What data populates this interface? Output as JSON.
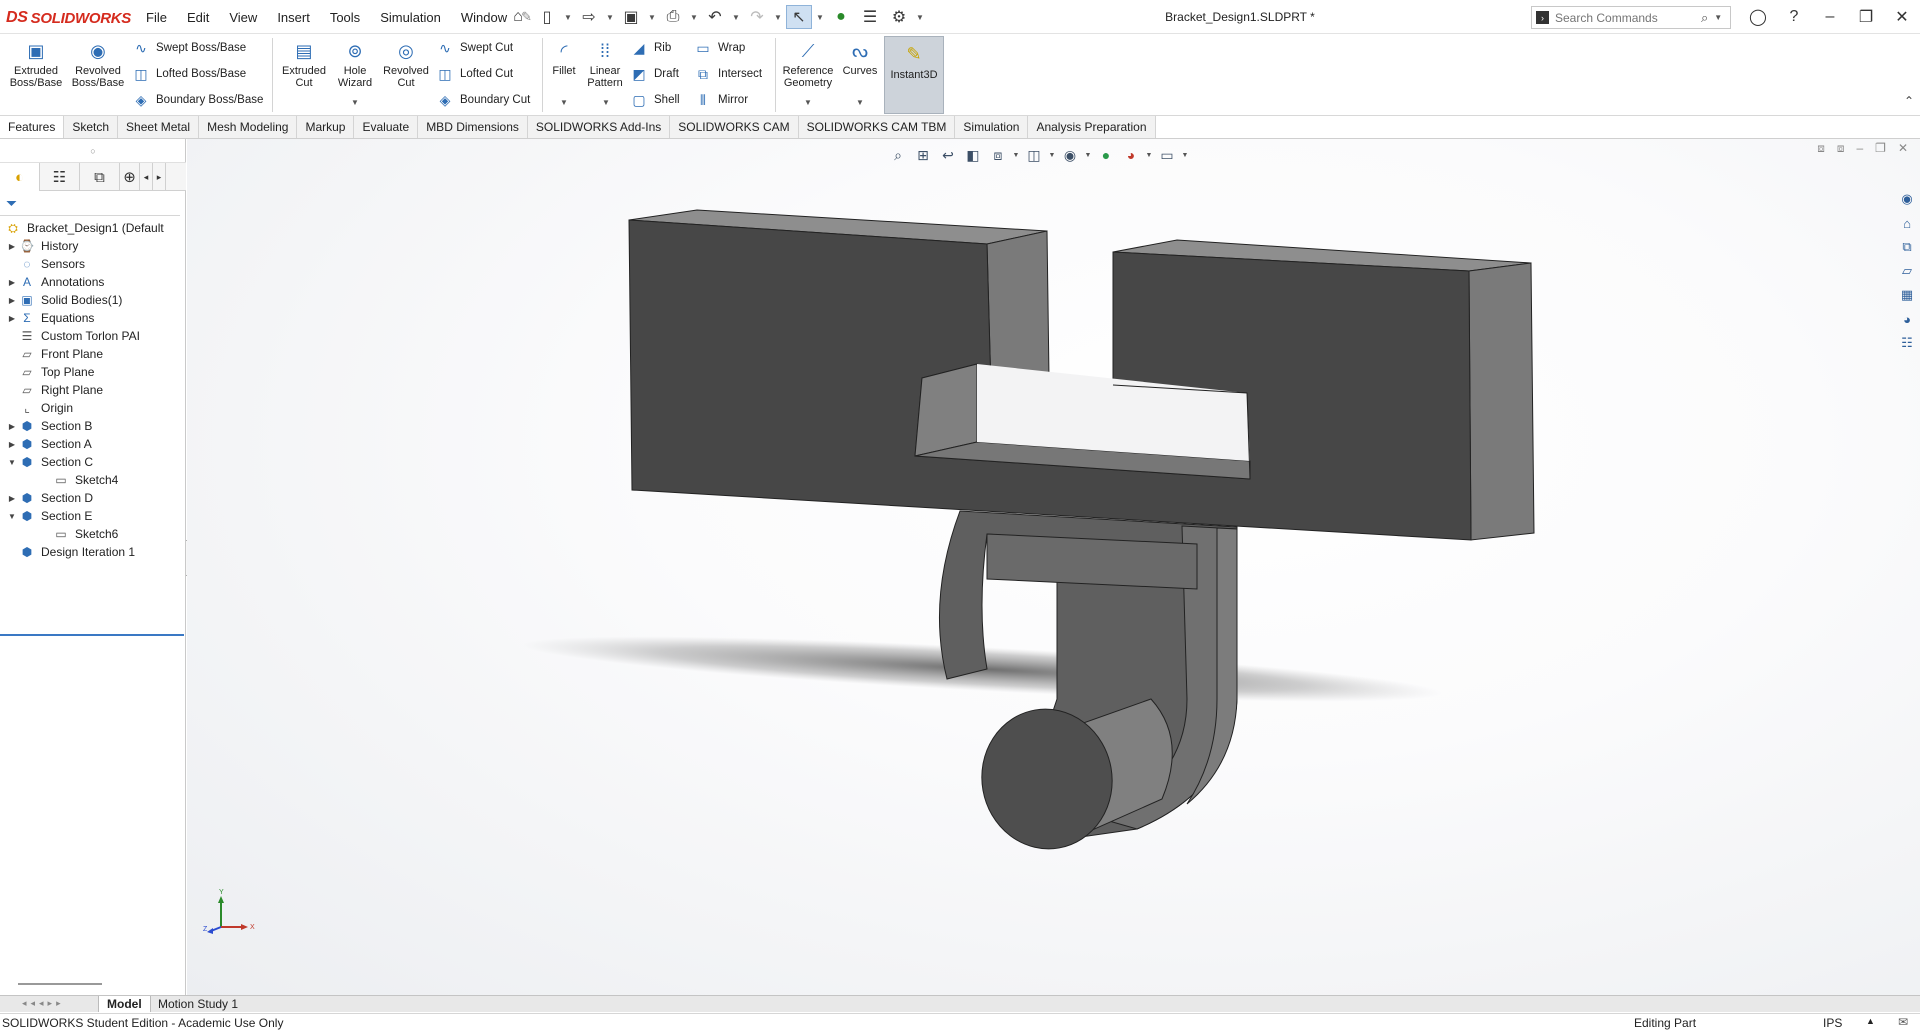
{
  "app": {
    "logo_text": "SOLIDWORKS",
    "logo_mark": "DS",
    "document_title": "Bracket_Design1.SLDPRT *",
    "search_placeholder": "Search Commands"
  },
  "menu": [
    "File",
    "Edit",
    "View",
    "Insert",
    "Tools",
    "Simulation",
    "Window"
  ],
  "ribbon": {
    "extruded_boss": "Extruded Boss/Base",
    "revolved_boss": "Revolved Boss/Base",
    "swept_boss": "Swept Boss/Base",
    "lofted_boss": "Lofted Boss/Base",
    "boundary_boss": "Boundary Boss/Base",
    "extruded_cut": "Extruded Cut",
    "hole_wizard": "Hole Wizard",
    "revolved_cut": "Revolved Cut",
    "swept_cut": "Swept Cut",
    "lofted_cut": "Lofted Cut",
    "boundary_cut": "Boundary Cut",
    "fillet": "Fillet",
    "linear_pattern": "Linear Pattern",
    "rib": "Rib",
    "draft": "Draft",
    "shell": "Shell",
    "wrap": "Wrap",
    "intersect": "Intersect",
    "mirror": "Mirror",
    "reference_geometry": "Reference Geometry",
    "curves": "Curves",
    "instant3d": "Instant3D"
  },
  "tabs": [
    "Features",
    "Sketch",
    "Sheet Metal",
    "Mesh Modeling",
    "Markup",
    "Evaluate",
    "MBD Dimensions",
    "SOLIDWORKS Add-Ins",
    "SOLIDWORKS CAM",
    "SOLIDWORKS CAM TBM",
    "Simulation",
    "Analysis Preparation"
  ],
  "tree": [
    {
      "label": "Bracket_Design1 (Default",
      "icon": "part-icon",
      "expand": "",
      "indent": 0
    },
    {
      "label": "History",
      "icon": "history-icon",
      "expand": "▶",
      "indent": 1
    },
    {
      "label": "Sensors",
      "icon": "sensors-icon",
      "expand": "",
      "indent": 1
    },
    {
      "label": "Annotations",
      "icon": "annotations-icon",
      "expand": "▶",
      "indent": 1
    },
    {
      "label": "Solid Bodies(1)",
      "icon": "solid-bodies-icon",
      "expand": "▶",
      "indent": 1
    },
    {
      "label": "Equations",
      "icon": "equations-icon",
      "expand": "▶",
      "indent": 1
    },
    {
      "label": "Custom Torlon PAI",
      "icon": "material-icon",
      "expand": "",
      "indent": 1
    },
    {
      "label": "Front Plane",
      "icon": "plane-icon",
      "expand": "",
      "indent": 1
    },
    {
      "label": "Top Plane",
      "icon": "plane-icon",
      "expand": "",
      "indent": 1
    },
    {
      "label": "Right Plane",
      "icon": "plane-icon",
      "expand": "",
      "indent": 1
    },
    {
      "label": "Origin",
      "icon": "origin-icon",
      "expand": "",
      "indent": 1
    },
    {
      "label": "Section B",
      "icon": "feature-icon",
      "expand": "▶",
      "indent": 1
    },
    {
      "label": "Section A",
      "icon": "feature-icon",
      "expand": "▶",
      "indent": 1
    },
    {
      "label": "Section C",
      "icon": "feature-icon",
      "expand": "▼",
      "indent": 1
    },
    {
      "label": "Sketch4",
      "icon": "sketch-icon",
      "expand": "",
      "indent": 2
    },
    {
      "label": "Section D",
      "icon": "feature-icon",
      "expand": "▶",
      "indent": 1
    },
    {
      "label": "Section E",
      "icon": "feature-icon",
      "expand": "▼",
      "indent": 1
    },
    {
      "label": "Sketch6",
      "icon": "sketch-icon",
      "expand": "",
      "indent": 2
    },
    {
      "label": "Design Iteration 1",
      "icon": "feature-icon",
      "expand": "",
      "indent": 1
    }
  ],
  "bottom_tabs": [
    "Model",
    "Motion Study 1"
  ],
  "status": {
    "left": "SOLIDWORKS Student Edition - Academic Use Only",
    "editing": "Editing Part",
    "units": "IPS"
  },
  "triad": {
    "x": "X",
    "y": "Y",
    "z": "Z"
  },
  "colors": {
    "brand": "#d52b1e",
    "model_face": "#4a4a4a",
    "model_side": "#7a7a7a",
    "model_top": "#8c8c8c",
    "accent": "#3a78c4"
  }
}
